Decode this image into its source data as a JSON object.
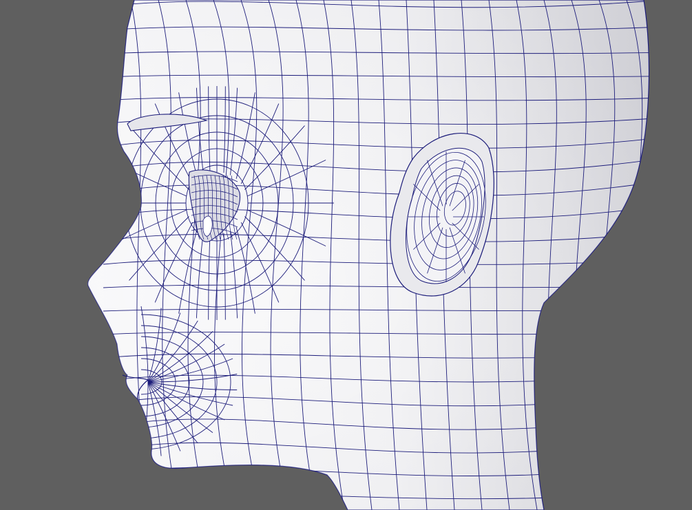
{
  "viewport": {
    "background_color": "#5f5f5f",
    "mesh_fill_light": "#f2f2f4",
    "mesh_fill_shade": "#c9c9cf",
    "wire_color": "#1c1c7a",
    "object_icon": "head-mesh-icon"
  }
}
